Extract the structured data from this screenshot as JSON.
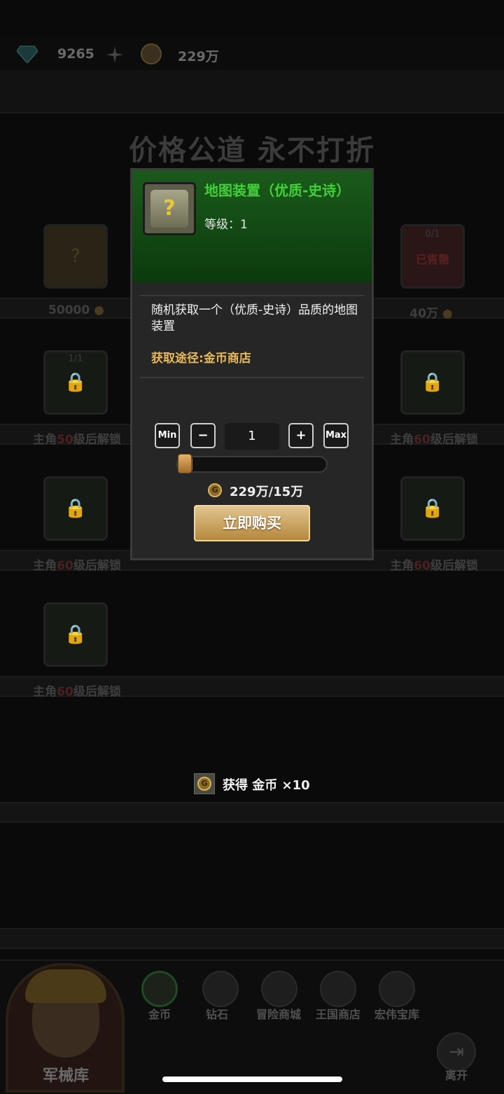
{
  "top_bar": {
    "diamonds": "9265",
    "gold": "229万",
    "icons": [
      "gem-icon",
      "plus-icon",
      "coin-icon"
    ]
  },
  "shop": {
    "title": "价格公道 永不打折",
    "slots": [
      {
        "price": "50000"
      },
      {
        "price": "40万",
        "sold_badge": "已售罄",
        "limit": "0/1"
      },
      {
        "limit": "1/1",
        "prefix": "主角",
        "level": "50",
        "suffix": "级后解锁"
      },
      {
        "prefix": "主角",
        "level": "60",
        "suffix": "级后解锁"
      },
      {
        "prefix": "主角",
        "level": "60",
        "suffix": "级后解锁"
      },
      {
        "prefix": "主角",
        "level": "60",
        "suffix": "级后解锁"
      },
      {
        "prefix": "主角",
        "level": "60",
        "suffix": "级后解锁"
      }
    ]
  },
  "popup": {
    "item_name": "地图装置（优质-史诗）",
    "level": "等级：1",
    "description": "随机获取一个（优质-史诗）品质的地图装置",
    "source": "获取途径:金币商店",
    "btn_min": "Min",
    "btn_minus": "−",
    "quantity": "1",
    "btn_plus": "+",
    "btn_max": "Max",
    "slider_fraction": 0.0,
    "price": "229万/15万",
    "buy_label": "立即购买",
    "colors": {
      "name": "#43cf3a",
      "source": "#e8b95a",
      "header_bg": "#1b5a1b"
    }
  },
  "toast": {
    "text": "获得 金币 ×10"
  },
  "bottom_nav": {
    "armory": "军械库",
    "tabs": [
      {
        "label": "金币",
        "icon": "coin-icon",
        "active": true
      },
      {
        "label": "钻石",
        "icon": "diamond-icon"
      },
      {
        "label": "冒险商城",
        "icon": "helmet-icon"
      },
      {
        "label": "王国商店",
        "icon": "crown-icon"
      },
      {
        "label": "宏伟宝库",
        "icon": "treasure-icon"
      }
    ],
    "exit": "离开"
  }
}
